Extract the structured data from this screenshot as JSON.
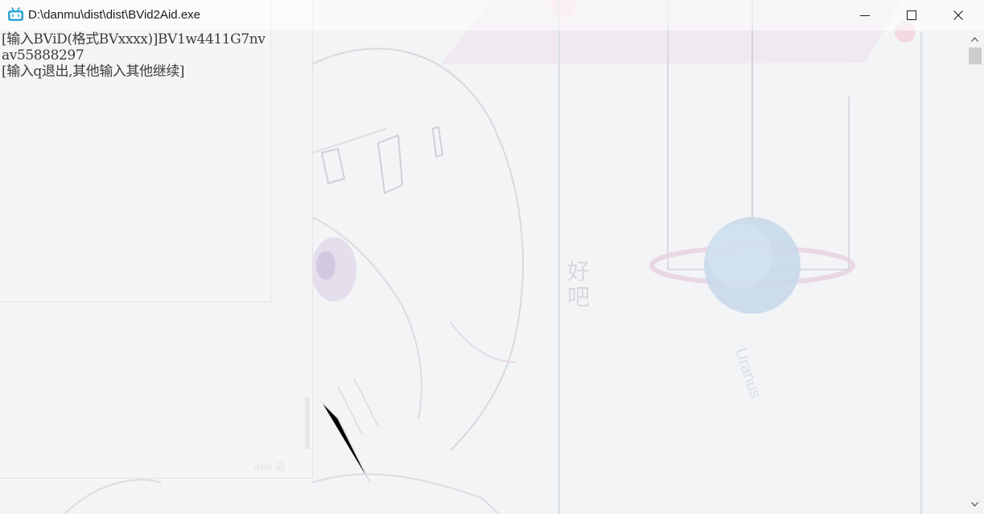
{
  "window": {
    "title": "D:\\danmu\\dist\\dist\\BVid2Aid.exe",
    "icon": "bilibili-tv-icon",
    "accent_color": "#2ea4d8"
  },
  "controls": {
    "minimize_icon": "minimize-icon",
    "maximize_icon": "maximize-icon",
    "close_icon": "close-icon"
  },
  "console": {
    "lines": [
      "[输入BViD(格式BVxxxx)]BV1w4411G7nv",
      "av55888297",
      "[输入q退出,其他输入其他继续]"
    ],
    "text_color": "#3c3c3c"
  },
  "scrollbar": {
    "up_icon": "scroll-up-arrow-icon",
    "down_icon": "scroll-down-arrow-icon"
  },
  "background": {
    "word_count": "468 词",
    "vertical_text": [
      "好",
      "吧"
    ],
    "planet_label": "Uranus"
  }
}
